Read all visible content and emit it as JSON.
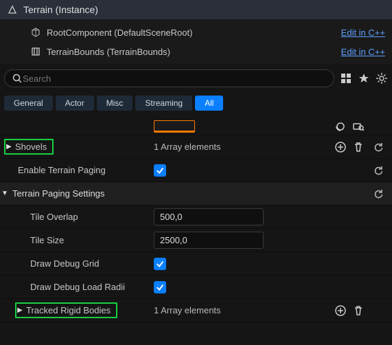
{
  "header": {
    "title": "Terrain (Instance)"
  },
  "tree": {
    "items": [
      {
        "label": "RootComponent (DefaultSceneRoot)",
        "action": "Edit in C++"
      },
      {
        "label": "TerrainBounds (TerrainBounds)",
        "action": "Edit in C++"
      }
    ]
  },
  "search": {
    "placeholder": "Search"
  },
  "tabs": {
    "items": [
      "General",
      "Actor",
      "Misc",
      "Streaming",
      "All"
    ],
    "active": 4
  },
  "props": {
    "shovels": {
      "label": "Shovels",
      "value": "1 Array elements"
    },
    "enablePaging": {
      "label": "Enable Terrain Paging",
      "checked": true
    },
    "paging": {
      "header": "Terrain Paging Settings",
      "tileOverlap": {
        "label": "Tile Overlap",
        "value": "500,0"
      },
      "tileSize": {
        "label": "Tile Size",
        "value": "2500,0"
      },
      "drawDebugGrid": {
        "label": "Draw Debug Grid",
        "checked": true
      },
      "drawDebugLoadRadii": {
        "label": "Draw Debug Load Radii",
        "checked": true
      },
      "trackedBodies": {
        "label": "Tracked Rigid Bodies",
        "value": "1 Array elements"
      }
    }
  },
  "icons": {
    "header": "class-icon",
    "root": "node-icon",
    "bounds": "bounds-icon"
  }
}
